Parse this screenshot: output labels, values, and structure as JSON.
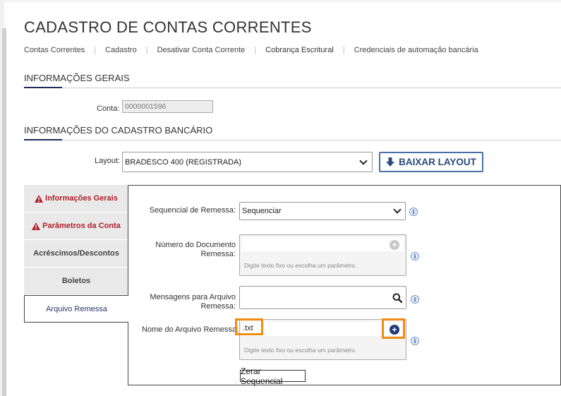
{
  "page": {
    "title": "CADASTRO DE CONTAS CORRENTES"
  },
  "breadcrumb": [
    {
      "label": "Contas Correntes"
    },
    {
      "label": "Cadastro"
    },
    {
      "label": "Desativar Conta Corrente"
    },
    {
      "label": "Cobrança Escritural"
    },
    {
      "label": "Credenciais de automação bancária"
    }
  ],
  "general_info": {
    "title": "INFORMAÇÕES GERAIS",
    "account_label": "Conta:",
    "account_value": "0000001596"
  },
  "bank_info": {
    "title": "INFORMAÇÕES DO CADASTRO BANCÁRIO",
    "layout_label": "Layout:",
    "layout_value": "BRADESCO 400 (REGISTRADA)",
    "download_button": "BAIXAR LAYOUT"
  },
  "tabs": [
    {
      "label": "Informações Gerais",
      "state": "error"
    },
    {
      "label": "Parâmetros da Conta",
      "state": "error"
    },
    {
      "label": "Acréscimos/Descontos",
      "state": "normal"
    },
    {
      "label": "Boletos",
      "state": "normal"
    },
    {
      "label": "Arquivo Remessa",
      "state": "active"
    }
  ],
  "remessa": {
    "sequencial_label": "Sequencial de Remessa:",
    "sequencial_value": "Sequenciar",
    "numero_doc_label_1": "Número do Documento",
    "numero_doc_label_2": "Remessa:",
    "numero_doc_value": "",
    "param_hint": "Digite texto fixo ou escolha um parâmetro.",
    "mensagens_label_1": "Mensagens para Arquivo",
    "mensagens_label_2": "Remessa:",
    "mensagens_value": "",
    "nome_arquivo_label": "Nome do Arquivo Remessa:",
    "nome_arquivo_value": ".txt",
    "zerar_button": "Zerar Sequencial",
    "zerar_dot": "."
  },
  "icons": {
    "info": "i",
    "warning": "warning-icon",
    "search": "search-icon",
    "plus": "plus-circle-icon",
    "download": "download-arrow-icon"
  },
  "colors": {
    "primary_navy": "#1f2b5a",
    "error_red": "#b0202a",
    "button_blue": "#2a4a80",
    "highlight_orange": "#f08c14",
    "plus_active": "#1f3a7a",
    "plus_inactive": "#c8c8c8"
  }
}
